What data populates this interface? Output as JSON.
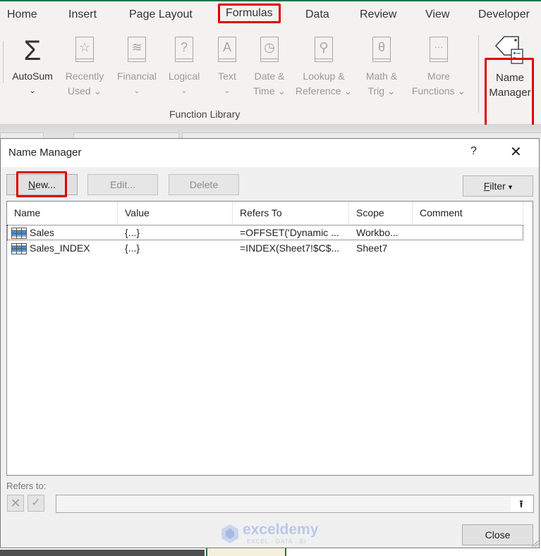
{
  "ribbon_tabs": [
    {
      "label": "Home",
      "active": false
    },
    {
      "label": "Insert",
      "active": false
    },
    {
      "label": "Page Layout",
      "active": false
    },
    {
      "label": "Formulas",
      "active": true
    },
    {
      "label": "Data",
      "active": false
    },
    {
      "label": "Review",
      "active": false
    },
    {
      "label": "View",
      "active": false
    },
    {
      "label": "Developer",
      "active": false
    }
  ],
  "ribbon": {
    "group_label": "Function Library",
    "buttons": [
      {
        "line1": "AutoSum",
        "line2": "⌄",
        "icon": "sigma-icon",
        "glyph": "Σ",
        "enabled": true
      },
      {
        "line1": "Recently",
        "line2": "Used ⌄",
        "icon": "star-book-icon",
        "glyph": "☆",
        "enabled": false
      },
      {
        "line1": "Financial",
        "line2": "⌄",
        "icon": "database-book-icon",
        "glyph": "≋",
        "enabled": false
      },
      {
        "line1": "Logical",
        "line2": "⌄",
        "icon": "question-book-icon",
        "glyph": "?",
        "enabled": false
      },
      {
        "line1": "Text",
        "line2": "⌄",
        "icon": "text-book-icon",
        "glyph": "A",
        "enabled": false
      },
      {
        "line1": "Date &",
        "line2": "Time ⌄",
        "icon": "clock-book-icon",
        "glyph": "◷",
        "enabled": false
      },
      {
        "line1": "Lookup &",
        "line2": "Reference ⌄",
        "icon": "magnifier-book-icon",
        "glyph": "⚲",
        "enabled": false
      },
      {
        "line1": "Math &",
        "line2": "Trig ⌄",
        "icon": "theta-book-icon",
        "glyph": "θ",
        "enabled": false
      },
      {
        "line1": "More",
        "line2": "Functions ⌄",
        "icon": "ellipsis-book-icon",
        "glyph": "···",
        "enabled": false
      }
    ],
    "name_manager": {
      "line1": "Name",
      "line2": "Manager",
      "icon": "name-tag-icon"
    }
  },
  "dialog": {
    "title": "Name Manager",
    "help": "?",
    "close_glyph": "✕",
    "buttons": {
      "new": {
        "accel": "N",
        "rest": "ew..."
      },
      "edit": "Edit...",
      "delete": "Delete",
      "filter": {
        "accel": "F",
        "rest": "ilter",
        "arrow": "▾"
      }
    },
    "columns": [
      "Name",
      "Value",
      "Refers To",
      "Scope",
      "Comment"
    ],
    "rows": [
      {
        "name": "Sales",
        "value": "{...}",
        "refers_to": "=OFFSET('Dynamic ...",
        "scope": "Workbo...",
        "comment": "",
        "selected": true
      },
      {
        "name": "Sales_INDEX",
        "value": "{...}",
        "refers_to": "=INDEX(Sheet7!$C$...",
        "scope": "Sheet7",
        "comment": "",
        "selected": false
      }
    ],
    "refers_to_label": "Refers to:",
    "refers_to_value": "",
    "cancel_glyph": "✕",
    "confirm_glyph": "✓",
    "collapse_glyph": "⭱",
    "close_label": "Close"
  },
  "watermark": {
    "brand": "exceldemy",
    "tagline": "EXCEL · DATA · BI"
  },
  "colors": {
    "highlight": "#e00000",
    "excel_green": "#217346",
    "table_icon": "#4a90d9"
  }
}
